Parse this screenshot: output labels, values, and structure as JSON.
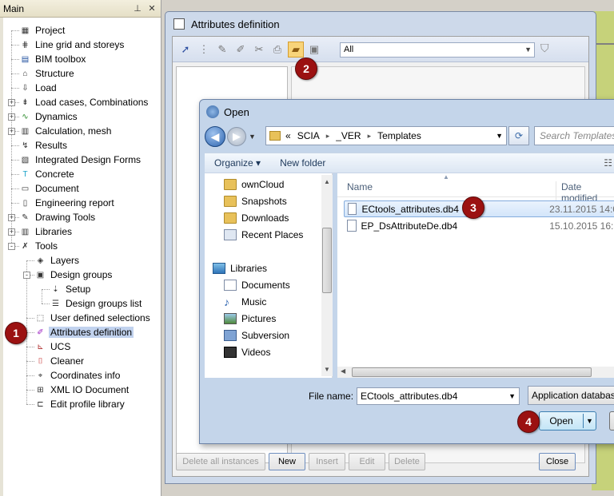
{
  "main_panel": {
    "title": "Main",
    "pin_icon": "pin-icon",
    "close_icon": "close-icon",
    "tree": [
      {
        "label": "Project",
        "icon": "project-icon"
      },
      {
        "label": "Line grid and storeys",
        "icon": "grid-icon"
      },
      {
        "label": "BIM toolbox",
        "icon": "bim-icon"
      },
      {
        "label": "Structure",
        "icon": "structure-icon"
      },
      {
        "label": "Load",
        "icon": "load-icon"
      },
      {
        "label": "Load cases, Combinations",
        "icon": "loadcases-icon"
      },
      {
        "label": "Dynamics",
        "icon": "dynamics-icon"
      },
      {
        "label": "Calculation, mesh",
        "icon": "calculator-icon"
      },
      {
        "label": "Results",
        "icon": "results-icon"
      },
      {
        "label": "Integrated Design Forms",
        "icon": "design-forms-icon"
      },
      {
        "label": "Concrete",
        "icon": "concrete-icon"
      },
      {
        "label": "Document",
        "icon": "document-icon"
      },
      {
        "label": "Engineering report",
        "icon": "report-icon"
      },
      {
        "label": "Drawing Tools",
        "icon": "drawing-tools-icon"
      },
      {
        "label": "Libraries",
        "icon": "libraries-icon"
      },
      {
        "label": "Tools",
        "icon": "tools-icon"
      },
      {
        "label": "Layers",
        "icon": "layers-icon"
      },
      {
        "label": "Design groups",
        "icon": "design-groups-icon"
      },
      {
        "label": "Setup",
        "icon": "setup-icon"
      },
      {
        "label": "Design groups list",
        "icon": "list-icon"
      },
      {
        "label": "User defined selections",
        "icon": "selection-icon"
      },
      {
        "label": "Attributes definition",
        "icon": "attributes-icon"
      },
      {
        "label": "UCS",
        "icon": "ucs-icon"
      },
      {
        "label": "Cleaner",
        "icon": "cleaner-icon"
      },
      {
        "label": "Coordinates info",
        "icon": "coordinates-icon"
      },
      {
        "label": "XML IO Document",
        "icon": "xml-icon"
      },
      {
        "label": "Edit profile library",
        "icon": "profile-icon"
      }
    ]
  },
  "attr_window": {
    "title": "Attributes definition",
    "filter_value": "All",
    "buttons": {
      "delete_all": "Delete all instances",
      "new": "New",
      "insert": "Insert",
      "edit": "Edit",
      "delete": "Delete",
      "close": "Close"
    }
  },
  "open_dialog": {
    "title": "Open",
    "path": [
      "«",
      "SCIA",
      "_VER",
      "Templates"
    ],
    "search_placeholder": "Search Templates",
    "organize": "Organize ▾",
    "new_folder": "New folder",
    "nav_items": [
      {
        "label": "ownCloud",
        "icon": "folder-icon"
      },
      {
        "label": "Snapshots",
        "icon": "folder-icon"
      },
      {
        "label": "Downloads",
        "icon": "downloads-icon"
      },
      {
        "label": "Recent Places",
        "icon": "recent-places-icon"
      },
      {
        "label": "Libraries",
        "icon": "libraries-icon"
      },
      {
        "label": "Documents",
        "icon": "documents-icon"
      },
      {
        "label": "Music",
        "icon": "music-icon"
      },
      {
        "label": "Pictures",
        "icon": "pictures-icon"
      },
      {
        "label": "Subversion",
        "icon": "subversion-icon"
      },
      {
        "label": "Videos",
        "icon": "videos-icon"
      }
    ],
    "columns": {
      "name": "Name",
      "date": "Date modified"
    },
    "files": [
      {
        "name": "ECtools_attributes.db4",
        "date": "23.11.2015 14:0",
        "selected": true
      },
      {
        "name": "EP_DsAttributeDe.db4",
        "date": "15.10.2015 16:5",
        "selected": false
      }
    ],
    "file_name_label": "File name:",
    "file_name_value": "ECtools_attributes.db4",
    "file_type": "Application databas",
    "open_label": "Open"
  },
  "step_badges": [
    "1",
    "2",
    "3",
    "4"
  ],
  "colors": {
    "badge": "#9b1111",
    "selection": "#c1d2ee",
    "dialog_frame": "#c4d5ea"
  }
}
